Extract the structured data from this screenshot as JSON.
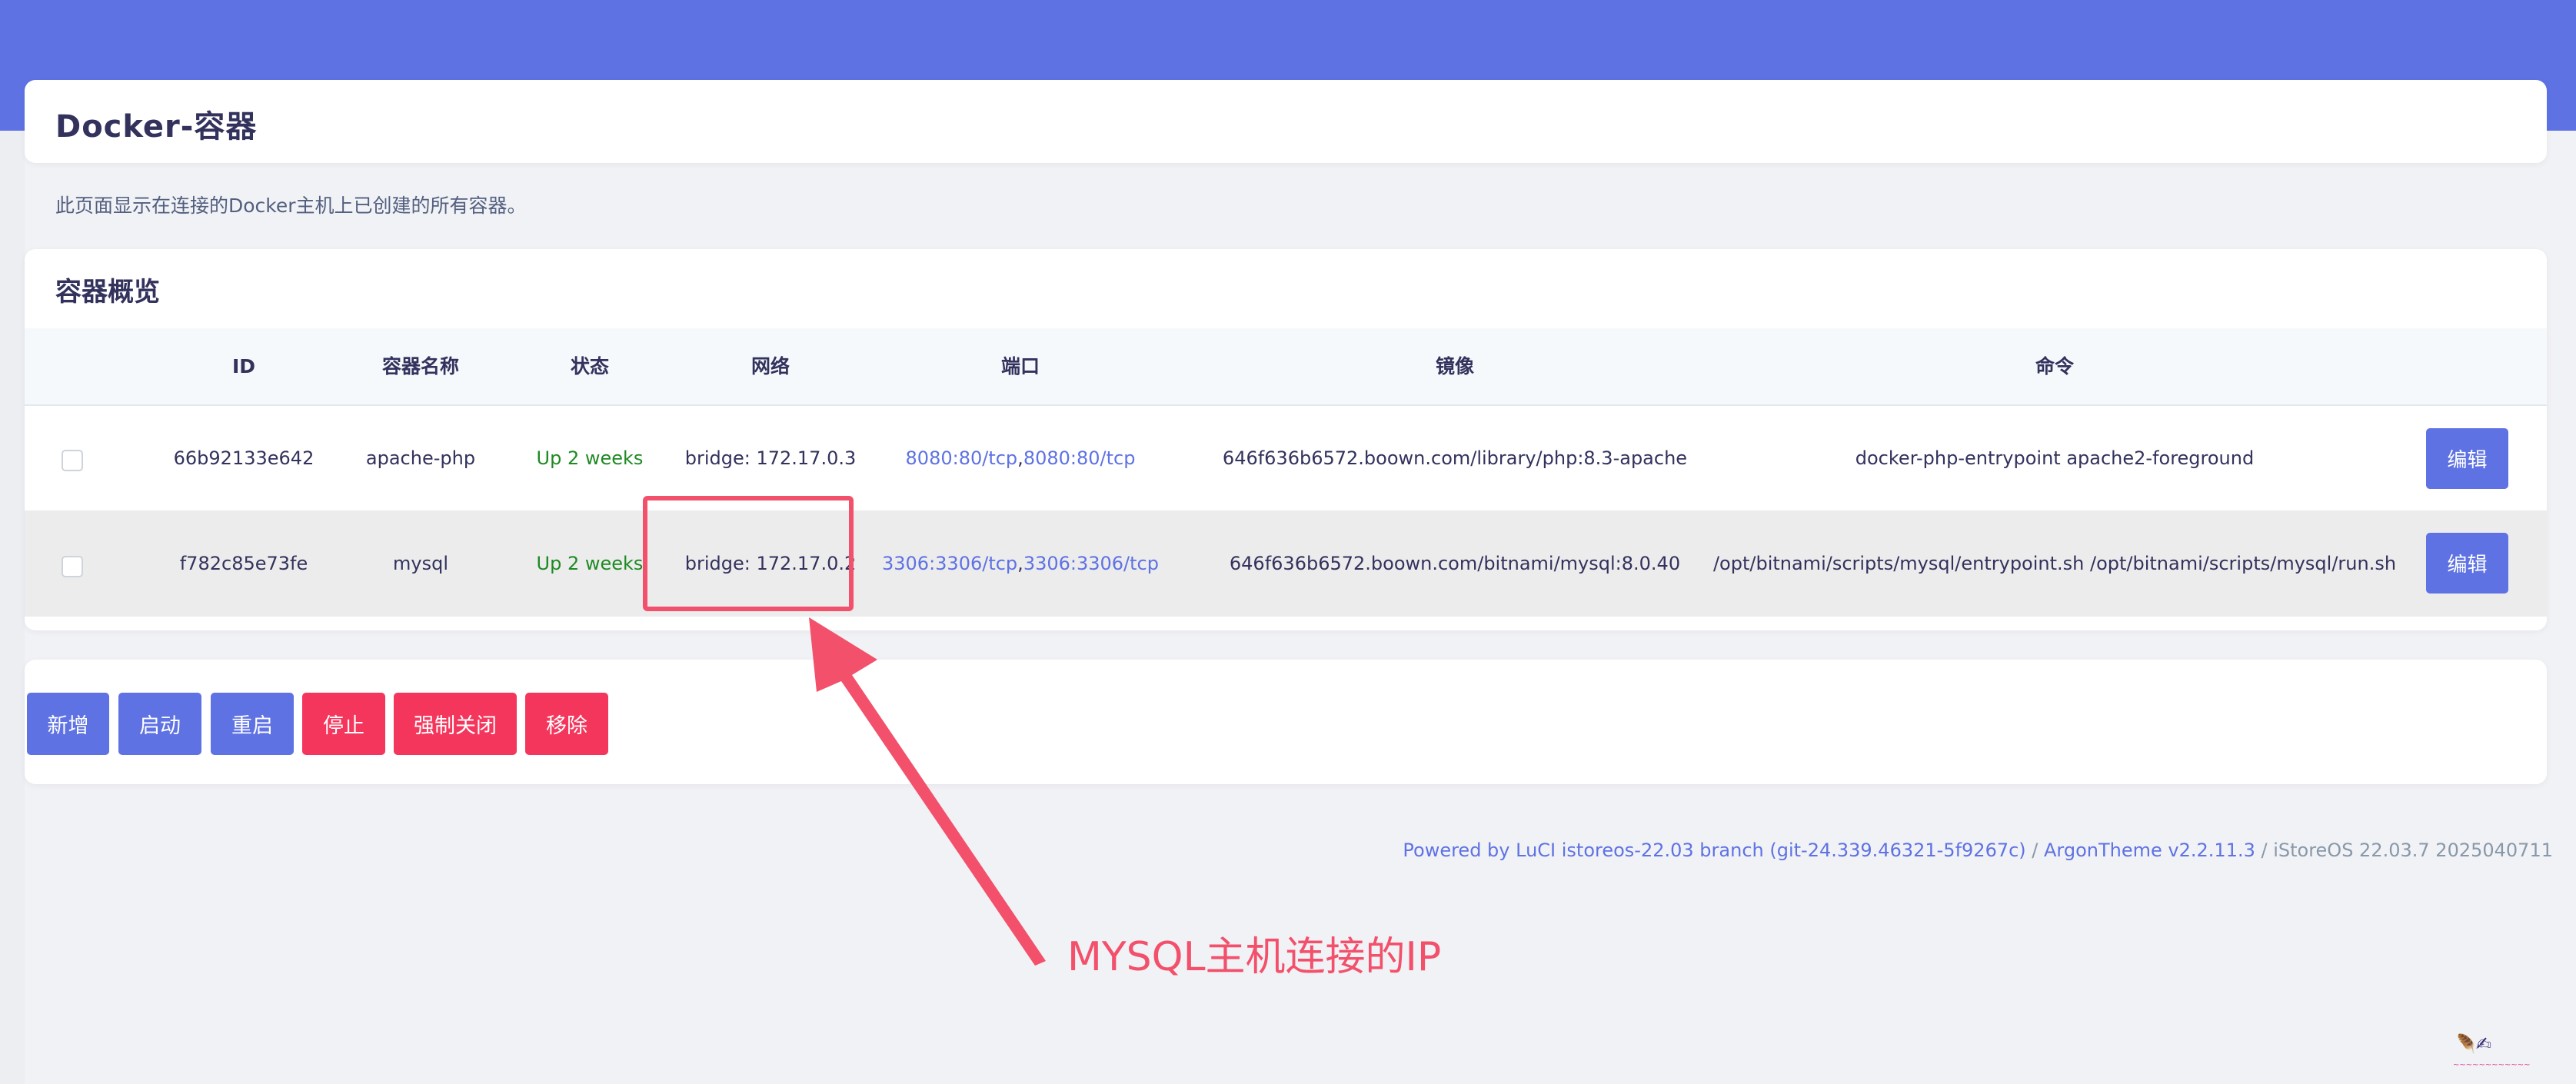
{
  "header": {
    "title": "Docker-容器",
    "description": "此页面显示在连接的Docker主机上已创建的所有容器。"
  },
  "overview": {
    "title": "容器概览",
    "columns": [
      "ID",
      "容器名称",
      "状态",
      "网络",
      "端口",
      "镜像",
      "命令"
    ],
    "rows": [
      {
        "id": "66b92133e642",
        "name": "apache-php",
        "status": "Up 2 weeks",
        "network": "bridge: 172.17.0.3",
        "port_a": "8080:80/tcp",
        "port_sep": ", ",
        "port_b": "8080:80/tcp",
        "image": "646f636b6572.boown.com/library/php:8.3-apache",
        "command": "docker-php-entrypoint apache2-foreground",
        "edit_label": "编辑"
      },
      {
        "id": "f782c85e73fe",
        "name": "mysql",
        "status": "Up 2 weeks",
        "network": "bridge: 172.17.0.2",
        "port_a": "3306:3306/tcp",
        "port_sep": ", ",
        "port_b": "3306:3306/tcp",
        "image": "646f636b6572.boown.com/bitnami/mysql:8.0.40",
        "command": "/opt/bitnami/scripts/mysql/entrypoint.sh /opt/bitnami/scripts/mysql/run.sh",
        "edit_label": "编辑"
      }
    ]
  },
  "actions": {
    "add": "新增",
    "start": "启动",
    "restart": "重启",
    "stop": "停止",
    "kill": "强制关闭",
    "remove": "移除"
  },
  "footer": {
    "powered": "Powered by LuCI istoreos-22.03 branch (git-24.339.46321-5f9267c)",
    "sep": " / ",
    "theme": "ArgonTheme v2.2.11.3",
    "version": "iStoreOS 22.03.7 2025040711"
  },
  "annotation": {
    "text": "MYSQL主机连接的IP"
  },
  "colors": {
    "primary": "#5e72e4",
    "danger": "#f5365c",
    "success": "#1e8a22",
    "annotation": "#f2506b"
  }
}
